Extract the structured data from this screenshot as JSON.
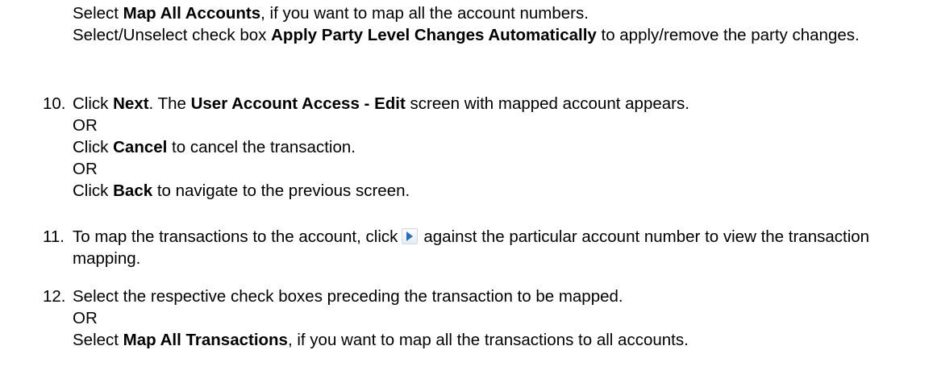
{
  "intro": {
    "line1": {
      "pre": "Select ",
      "bold": "Map All Accounts",
      "post": ", if you want to map all the account numbers."
    },
    "line2": {
      "pre": "Select/Unselect check box ",
      "bold": "Apply Party Level Changes Automatically",
      "post": " to apply/remove the party changes."
    }
  },
  "steps": [
    {
      "number": "10.",
      "a_pre": "Click ",
      "a_bold1": "Next",
      "a_mid": ". The ",
      "a_bold2": "User Account Access - Edit",
      "a_post": " screen with mapped account appears.",
      "or1": "OR",
      "b_pre": "Click ",
      "b_bold": "Cancel",
      "b_post": " to cancel the transaction.",
      "or2": "OR",
      "c_pre": "Click ",
      "c_bold": "Back",
      "c_post": " to navigate to the previous screen."
    },
    {
      "number": "11.",
      "pre": "To map the transactions to the account, click",
      "icon": "expand-arrow-icon",
      "post": "against the particular account number to view the transaction mapping."
    },
    {
      "number": "12.",
      "a": "Select the respective check boxes preceding the transaction to be mapped.",
      "or": "OR",
      "b_pre": "Select ",
      "b_bold": "Map All Transactions",
      "b_post": ", if you want to map all the transactions to all accounts."
    }
  ],
  "colors": {
    "text": "#000000",
    "icon_arrow": "#2a6ebb",
    "background": "#ffffff"
  }
}
